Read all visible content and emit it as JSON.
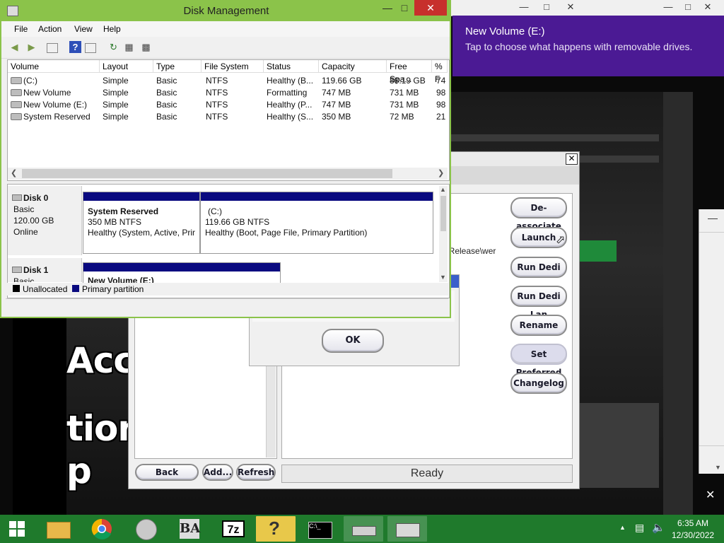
{
  "disk_management": {
    "title": "Disk Management",
    "menu": [
      "File",
      "Action",
      "View",
      "Help"
    ],
    "columns": [
      "Volume",
      "Layout",
      "Type",
      "File System",
      "Status",
      "Capacity",
      "Free Spa...",
      "% F"
    ],
    "volumes": [
      {
        "name": "(C:)",
        "layout": "Simple",
        "type": "Basic",
        "fs": "NTFS",
        "status": "Healthy (B...",
        "capacity": "119.66 GB",
        "free": "88.19 GB",
        "pct": "74"
      },
      {
        "name": "New Volume",
        "layout": "Simple",
        "type": "Basic",
        "fs": "NTFS",
        "status": "Formatting",
        "capacity": "747 MB",
        "free": "731 MB",
        "pct": "98"
      },
      {
        "name": "New Volume (E:)",
        "layout": "Simple",
        "type": "Basic",
        "fs": "NTFS",
        "status": "Healthy (P...",
        "capacity": "747 MB",
        "free": "731 MB",
        "pct": "98"
      },
      {
        "name": "System Reserved",
        "layout": "Simple",
        "type": "Basic",
        "fs": "NTFS",
        "status": "Healthy (S...",
        "capacity": "350 MB",
        "free": "72 MB",
        "pct": "21"
      }
    ],
    "disk0": {
      "name": "Disk 0",
      "type": "Basic",
      "size": "120.00 GB",
      "state": "Online",
      "p1": {
        "name": "System Reserved",
        "size": "350 MB NTFS",
        "status": "Healthy (System, Active, Prir"
      },
      "p2": {
        "name": "(C:)",
        "size": "119.66 GB NTFS",
        "status": "Healthy (Boot, Page File, Primary Partition)"
      }
    },
    "disk1": {
      "name": "Disk 1",
      "type": "Basic",
      "p1": {
        "name": "New Volume (E:)"
      }
    },
    "legend": {
      "unallocated": "Unallocated",
      "primary": "Primary partition"
    }
  },
  "toast": {
    "title": "New Volume (E:)",
    "body": "Tap to choose what happens with removable drives."
  },
  "launcher": {
    "detail_text": "er-Release\\wer",
    "buttons": {
      "deassociate": "De-associate",
      "launch": "Launch",
      "run_dedi": "Run Dedi",
      "run_dedi_lan": "Run Dedi Lan",
      "rename": "Rename",
      "set_preferred": "Set Preferred",
      "changelog": "Changelog",
      "back": "Back",
      "add": "Add...",
      "refresh": "Refresh"
    },
    "status": "Ready"
  },
  "dialog": {
    "ok": "OK"
  },
  "background_text": [
    "Acce",
    "tions",
    "p"
  ],
  "taskbar": {
    "time": "6:35 AM",
    "date": "12/30/2022",
    "apps": [
      "start",
      "file-explorer",
      "chrome",
      "audio",
      "ba",
      "7zip",
      "help",
      "cmd",
      "drive",
      "disk-management"
    ]
  }
}
